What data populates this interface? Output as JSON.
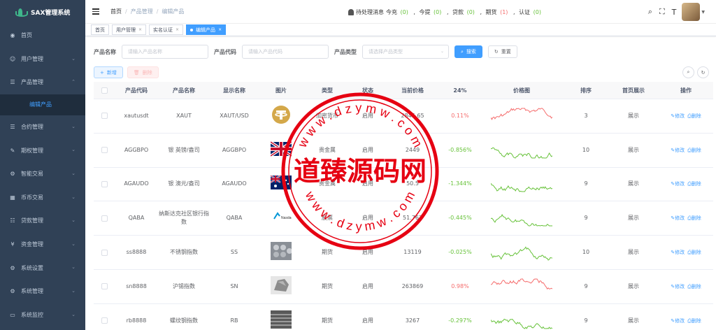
{
  "app": {
    "title": "SAX管理系统"
  },
  "sidebar": {
    "items": [
      {
        "label": "首页",
        "icon": "dashboard-icon"
      },
      {
        "label": "用户管理",
        "icon": "user-icon"
      },
      {
        "label": "产品管理",
        "icon": "document-icon",
        "open": true
      },
      {
        "label": "合约管理",
        "icon": "document-icon"
      },
      {
        "label": "期权管理",
        "icon": "edit-icon"
      },
      {
        "label": "智能交易",
        "icon": "gear-icon"
      },
      {
        "label": "币币交易",
        "icon": "table-icon"
      },
      {
        "label": "贷款管理",
        "icon": "loan-icon"
      },
      {
        "label": "资金管理",
        "icon": "money-icon"
      },
      {
        "label": "系统设置",
        "icon": "settings-icon"
      },
      {
        "label": "系统管理",
        "icon": "settings-icon"
      },
      {
        "label": "系统监控",
        "icon": "monitor-icon"
      }
    ],
    "submenu_active": "编辑产品"
  },
  "breadcrumb": [
    "首页",
    "产品管理",
    "编辑产品"
  ],
  "notice": {
    "label": "待处理消息",
    "items": [
      {
        "name": "今充",
        "count": "0",
        "color": "#67c23a"
      },
      {
        "name": "今提",
        "count": "0",
        "color": "#67c23a"
      },
      {
        "name": "贷款",
        "count": "0",
        "color": "#67c23a"
      },
      {
        "name": "期货",
        "count": "1",
        "color": "#f56c6c"
      },
      {
        "name": "认证",
        "count": "0",
        "color": "#67c23a"
      }
    ]
  },
  "tags": [
    {
      "label": "首页",
      "closable": false,
      "active": false
    },
    {
      "label": "用户管理",
      "closable": true,
      "active": false
    },
    {
      "label": "实名认证",
      "closable": true,
      "active": false
    },
    {
      "label": "编辑产品",
      "closable": true,
      "active": true
    }
  ],
  "search": {
    "name_label": "产品名称",
    "name_placeholder": "请输入产品名称",
    "code_label": "产品代码",
    "code_placeholder": "请输入产品代码",
    "type_label": "产品类型",
    "type_placeholder": "请选择产品类型",
    "search_button": "搜索",
    "reset_button": "重置"
  },
  "toolbar": {
    "add": "新增",
    "delete": "删除"
  },
  "table": {
    "headers": [
      "产品代码",
      "产品名称",
      "显示名称",
      "图片",
      "类型",
      "状态",
      "当前价格",
      "24%",
      "价格图",
      "排序",
      "首页展示",
      "操作"
    ],
    "rows": [
      {
        "code": "xautusdt",
        "name": "XAUT",
        "display": "XAUT/USD",
        "img": "tether",
        "type": "加密货币",
        "status": "启用",
        "price": "2845.65",
        "change": "0.11%",
        "trend": "up",
        "sort": "3",
        "home": "展示"
      },
      {
        "code": "AGGBPO",
        "name": "银 英镑/盎司",
        "display": "AGGBPO",
        "img": "uk-flag",
        "type": "贵金属",
        "status": "启用",
        "price": "2449",
        "change": "-0.856%",
        "trend": "down",
        "sort": "10",
        "home": "展示"
      },
      {
        "code": "AGAUDO",
        "name": "银 澳元/盎司",
        "display": "AGAUDO",
        "img": "au-flag",
        "type": "贵金属",
        "status": "启用",
        "price": "50.5",
        "change": "-1.344%",
        "trend": "down",
        "sort": "9",
        "home": "展示"
      },
      {
        "code": "QABA",
        "name": "纳斯达克社区银行指数",
        "display": "QABA",
        "img": "nasdaq",
        "type": "股票",
        "status": "启用",
        "price": "51.762",
        "change": "-0.445%",
        "trend": "down",
        "sort": "9",
        "home": "展示"
      },
      {
        "code": "ss8888",
        "name": "不锈钢指数",
        "display": "SS",
        "img": "steel",
        "type": "期货",
        "status": "启用",
        "price": "13119",
        "change": "-0.025%",
        "trend": "down",
        "sort": "10",
        "home": "展示"
      },
      {
        "code": "sn8888",
        "name": "沪锡指数",
        "display": "SN",
        "img": "tin",
        "type": "期货",
        "status": "启用",
        "price": "263869",
        "change": "0.98%",
        "trend": "up",
        "sort": "9",
        "home": "展示"
      },
      {
        "code": "rb8888",
        "name": "螺纹钢指数",
        "display": "RB",
        "img": "rebar",
        "type": "期货",
        "status": "启用",
        "price": "3267",
        "change": "-0.297%",
        "trend": "down",
        "sort": "9",
        "home": "展示"
      }
    ],
    "op_edit": "修改",
    "op_delete": "删除"
  },
  "watermark": {
    "text": "道臻源码网",
    "url": "w w w . d z y m w . c o m"
  },
  "colors": {
    "primary": "#409eff",
    "sidebar": "#304156",
    "up": "#f56c6c",
    "down": "#67c23a"
  }
}
